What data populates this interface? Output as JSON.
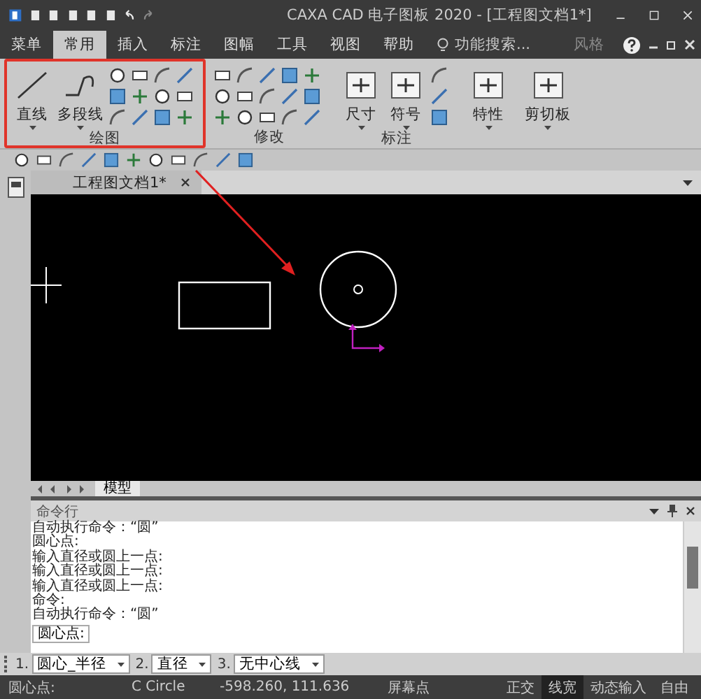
{
  "window": {
    "title": "CAXA CAD 电子图板 2020 - [工程图文档1*]"
  },
  "menu_tabs": [
    {
      "label": "菜单",
      "selected": false
    },
    {
      "label": "常用",
      "selected": true
    },
    {
      "label": "插入",
      "selected": false
    },
    {
      "label": "标注",
      "selected": false
    },
    {
      "label": "图幅",
      "selected": false
    },
    {
      "label": "工具",
      "selected": false
    },
    {
      "label": "视图",
      "selected": false
    },
    {
      "label": "帮助",
      "selected": false
    }
  ],
  "search": {
    "placeholder": "功能搜索..."
  },
  "style_menu": "风格",
  "ribbon": {
    "groups": [
      {
        "label": "绘图",
        "highlighted": true,
        "buttons": [
          "直线",
          "多段线"
        ]
      },
      {
        "label": "修改",
        "highlighted": false
      },
      {
        "label": "标注",
        "highlighted": false,
        "buttons": [
          "尺寸",
          "符号"
        ]
      },
      {
        "highlighted": false,
        "buttons": [
          "特性"
        ]
      },
      {
        "highlighted": false,
        "buttons": [
          "剪切板"
        ]
      }
    ]
  },
  "document_tab": {
    "label": "工程图文档1*"
  },
  "layout_tabs": [
    {
      "label": "模型",
      "selected": true
    }
  ],
  "annotation_arrow": true,
  "command_panel": {
    "title": "命令行",
    "lines": [
      "自动执行命令：“圆”",
      "圆心点:",
      "输入直径或圆上一点:",
      "输入直径或圆上一点:",
      "输入直径或圆上一点:",
      "命令:",
      "自动执行命令：“圆”"
    ],
    "prompt": "圆心点:"
  },
  "options": [
    {
      "index": "1.",
      "value": "圆心_半径"
    },
    {
      "index": "2.",
      "value": "直径"
    },
    {
      "index": "3.",
      "value": "无中心线"
    }
  ],
  "status_bar": {
    "prompt": "圆心点:",
    "command": "C Circle",
    "coordinates": "-598.260, 111.636",
    "snap": "屏幕点",
    "toggles": [
      {
        "label": "正交",
        "on": false
      },
      {
        "label": "线宽",
        "on": true
      },
      {
        "label": "动态输入",
        "on": false
      },
      {
        "label": "自由",
        "on": false
      }
    ]
  }
}
